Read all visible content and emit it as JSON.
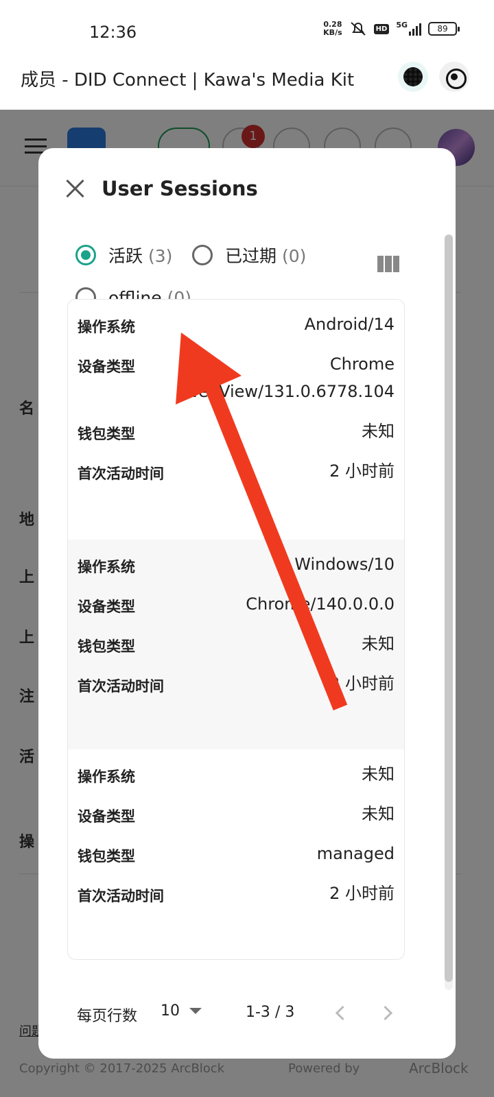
{
  "status_bar": {
    "time": "12:36",
    "net_speed_value": "0.28",
    "net_speed_unit": "KB/s",
    "hd": "HD",
    "network": "5G",
    "battery": "89"
  },
  "browser": {
    "title": "成员 - DID Connect | Kawa's Media Kit"
  },
  "background_page": {
    "notification_count": "1",
    "footer_link": "问题",
    "copyright": "Copyright © 2017-2025 ArcBlock",
    "powered_by": "Powered by",
    "brand": "ArcBlock"
  },
  "dialog": {
    "title": "User Sessions",
    "filters": [
      {
        "label": "活跃",
        "count": "(3)",
        "checked": true
      },
      {
        "label": "已过期",
        "count": "(0)",
        "checked": false
      },
      {
        "label": "offline",
        "count": "(0)",
        "checked": false
      }
    ],
    "sessions": [
      {
        "os_label": "操作系统",
        "os": "Android/14",
        "device_label": "设备类型",
        "device": "Chrome WebView/131.0.6778.104",
        "wallet_label": "钱包类型",
        "wallet": "未知",
        "first_active_label": "首次活动时间",
        "first_active": "2 小时前"
      },
      {
        "os_label": "操作系统",
        "os": "Windows/10",
        "device_label": "设备类型",
        "device": "Chrome/140.0.0.0",
        "wallet_label": "钱包类型",
        "wallet": "未知",
        "first_active_label": "首次活动时间",
        "first_active": "2 小时前"
      },
      {
        "os_label": "操作系统",
        "os": "未知",
        "device_label": "设备类型",
        "device": "未知",
        "wallet_label": "钱包类型",
        "wallet": "managed",
        "first_active_label": "首次活动时间",
        "first_active": "2 小时前"
      }
    ],
    "pagination": {
      "rows_per_page_label": "每页行数",
      "rows_per_page": "10",
      "range": "1-3 / 3"
    }
  },
  "colors": {
    "accent": "#1aa38a",
    "annotation_arrow": "#f03a1f",
    "badge": "#d32f2f"
  }
}
